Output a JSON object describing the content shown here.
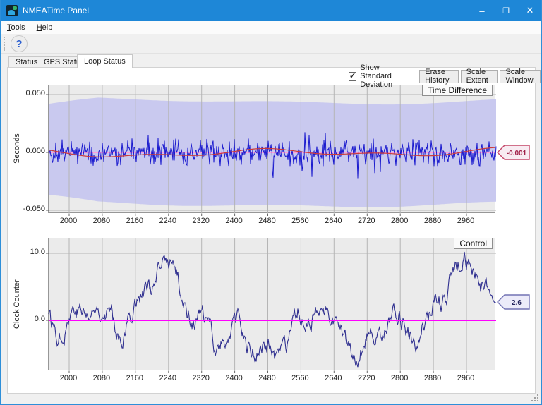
{
  "window": {
    "title": "NMEATime Panel",
    "minimize_glyph": "–",
    "maximize_glyph": "❒",
    "close_glyph": "✕"
  },
  "menu": {
    "items": [
      {
        "label": "Tools"
      },
      {
        "label": "Help"
      }
    ]
  },
  "toolbar": {
    "help_label": "?"
  },
  "tabs": [
    {
      "label": "Status",
      "active": false
    },
    {
      "label": "GPS Status",
      "active": false
    },
    {
      "label": "Loop Status",
      "active": true
    }
  ],
  "controls": {
    "show_std_label": "Show Standard Deviation",
    "show_std_checked": true,
    "checkmark_glyph": "✓",
    "buttons": [
      "Erase History",
      "Scale Extent",
      "Scale Window"
    ]
  },
  "chart_data": [
    {
      "type": "line",
      "title": "Time Difference",
      "ylabel": "Seconds",
      "yticks": [
        {
          "value": 0.05,
          "label": "0.050"
        },
        {
          "value": 0.0,
          "label": "0.000"
        },
        {
          "value": -0.05,
          "label": "-0.050"
        }
      ],
      "xticks": [
        "2000",
        "2080",
        "2160",
        "2240",
        "2320",
        "2400",
        "2480",
        "2560",
        "2640",
        "2720",
        "2800",
        "2880",
        "2960"
      ],
      "x_range": [
        1950,
        3032
      ],
      "y_range": [
        -0.053,
        0.058
      ],
      "current_value": -0.001,
      "current_value_label": "-0.001",
      "series": [
        {
          "name": "std-deviation-band",
          "approx_half_width": 0.045
        },
        {
          "name": "time-difference-signal",
          "approx_amplitude": 0.012
        },
        {
          "name": "mean-line",
          "approx_amplitude": 0.003
        },
        {
          "name": "zero-line",
          "value": 0.0
        }
      ],
      "colors": {
        "band": "#c9c9ef",
        "signal": "#1a1ace",
        "mean": "#cc3b3b",
        "zero": "#ff9ed9",
        "badge_border": "#c44668",
        "badge_bg": "#f8ecf2",
        "badge_text": "#a02048"
      },
      "gen": {
        "seed": 1337,
        "n": 634
      }
    },
    {
      "type": "line",
      "title": "Control",
      "ylabel": "Clock Counter",
      "yticks": [
        {
          "value": 10.0,
          "label": "10.0"
        },
        {
          "value": 0.0,
          "label": "0.0"
        }
      ],
      "xticks": [
        "2000",
        "2080",
        "2160",
        "2240",
        "2320",
        "2400",
        "2480",
        "2560",
        "2640",
        "2720",
        "2800",
        "2880",
        "2960"
      ],
      "x_range": [
        1950,
        3032
      ],
      "y_range": [
        -7.6,
        12.2
      ],
      "current_value": 2.6,
      "current_value_label": "2.6",
      "series": [
        {
          "name": "control-signal",
          "approx_range": [
            -8.5,
            11.5
          ]
        },
        {
          "name": "zero-line",
          "value": 0.0
        }
      ],
      "colors": {
        "line": "#2e2e8f",
        "zero": "#ff00ff",
        "badge_border": "#7272b4",
        "badge_bg": "#ecebf9",
        "badge_text": "#26265e"
      },
      "gen": {
        "seed": 77,
        "n": 634
      }
    }
  ]
}
